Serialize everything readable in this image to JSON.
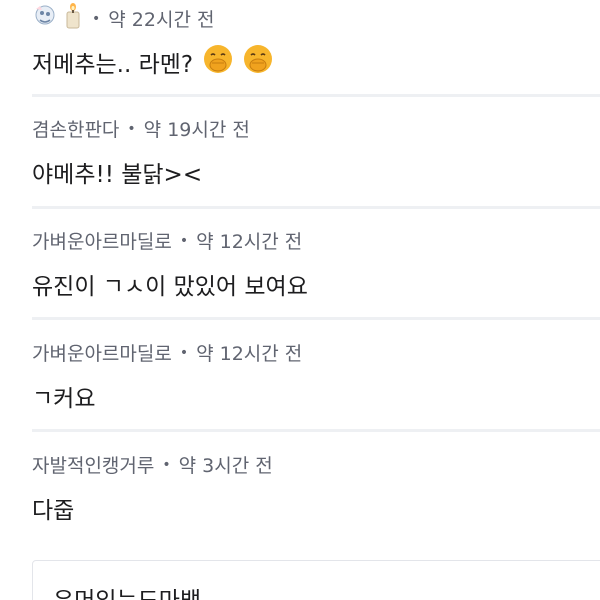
{
  "comments": [
    {
      "author": "",
      "time": "약 22시간 전",
      "text": "저메추는.. 라멘?"
    },
    {
      "author": "겸손한판다",
      "time": "약 19시간 전",
      "text": "야메추!! 불닭><"
    },
    {
      "author": "가벼운아르마딜로",
      "time": "약 12시간 전",
      "text": "유진이 ㄱㅅ이 맜있어 보여요"
    },
    {
      "author": "가벼운아르마딜로",
      "time": "약 12시간 전",
      "text": "ㄱ커요"
    },
    {
      "author": "자발적인캥거루",
      "time": "약 3시간 전",
      "text": "다줍"
    }
  ],
  "bottom_box": {
    "text": "유머있는도마뱀"
  },
  "meta_separator": "•",
  "colors": {
    "meta_text": "#606470",
    "body_text": "#1d1d1f",
    "divider": "#eef0f3",
    "emoji_face": "#f7b52c"
  },
  "icons": [
    "character-sticker-icon",
    "candle-icon",
    "face-with-hand-over-mouth-emoji"
  ]
}
